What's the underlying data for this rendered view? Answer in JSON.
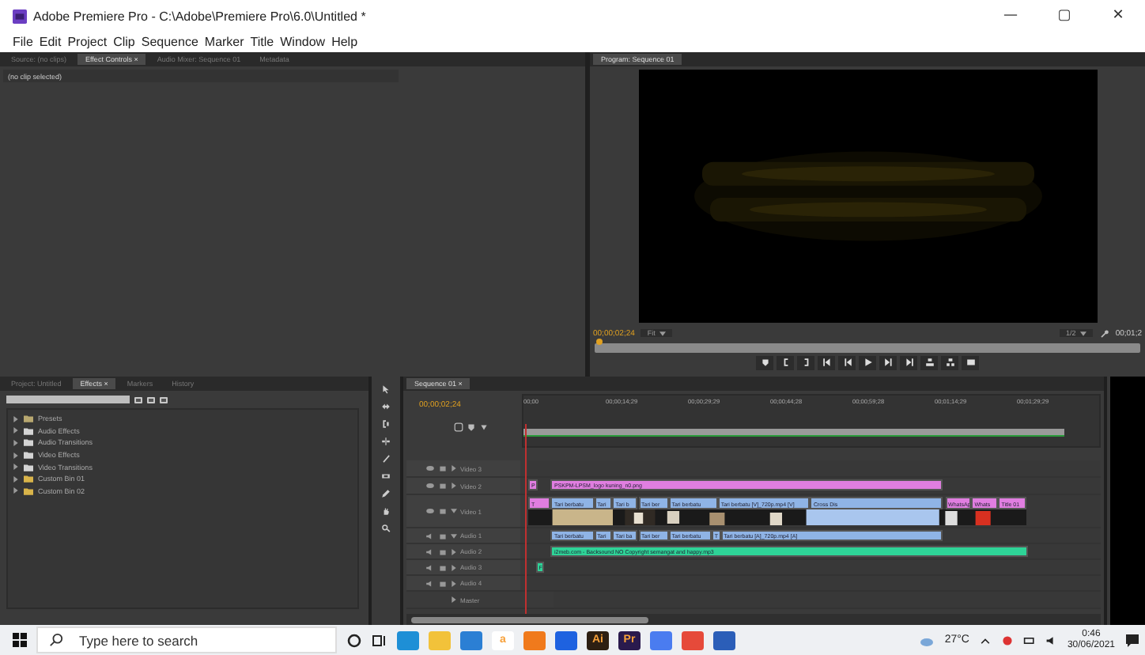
{
  "window": {
    "title": "Adobe Premiere Pro - C:\\Adobe\\Premiere Pro\\6.0\\Untitled *",
    "controls": [
      "—",
      "▢",
      "✕"
    ]
  },
  "menu": [
    "File",
    "Edit",
    "Project",
    "Clip",
    "Sequence",
    "Marker",
    "Title",
    "Window",
    "Help"
  ],
  "source_panel": {
    "tabs": [
      {
        "label": "Source: (no clips)",
        "selected": false
      },
      {
        "label": "Effect Controls ×",
        "selected": true
      },
      {
        "label": "Audio Mixer: Sequence 01",
        "selected": false
      },
      {
        "label": "Metadata",
        "selected": false
      }
    ],
    "message": "(no clip selected)"
  },
  "program_monitor": {
    "tab": "Program: Sequence 01",
    "timecode": "00;00;02;24",
    "fit": "Fit",
    "zoom": "1/2",
    "duration": "00;01;2"
  },
  "project_panel": {
    "tabs": [
      {
        "label": "Project: Untitled",
        "selected": false
      },
      {
        "label": "Effects ×",
        "selected": true
      },
      {
        "label": "Markers",
        "selected": false
      },
      {
        "label": "History",
        "selected": false
      }
    ],
    "items": [
      {
        "label": "Presets",
        "kind": "presets"
      },
      {
        "label": "Audio Effects",
        "kind": "folder"
      },
      {
        "label": "Audio Transitions",
        "kind": "folder"
      },
      {
        "label": "Video Effects",
        "kind": "folder"
      },
      {
        "label": "Video Transitions",
        "kind": "folder"
      },
      {
        "label": "Custom Bin 01",
        "kind": "bin"
      },
      {
        "label": "Custom Bin 02",
        "kind": "bin"
      }
    ]
  },
  "timeline": {
    "tab": "Sequence 01 ×",
    "timecode": "00;00;02;24",
    "ruler": [
      "00;00",
      "00;00;14;29",
      "00;00;29;29",
      "00;00;44;28",
      "00;00;59;28",
      "00;01;14;29",
      "00;01;29;29"
    ],
    "tracks": [
      {
        "name": "Video 3",
        "kind": "video",
        "expanded": false
      },
      {
        "name": "Video 2",
        "kind": "video",
        "expanded": false,
        "clips": [
          {
            "label": "P",
            "color": "#e07ee0"
          },
          {
            "label": "PSKPM-LPSM_logo kuning_n0.png",
            "color": "#e07ee0"
          }
        ]
      },
      {
        "name": "Video 1",
        "kind": "video",
        "expanded": true,
        "clips": [
          {
            "label": "T",
            "color": "#e07ee0"
          },
          {
            "label": "Tari berbatu",
            "color": "#8fb4e6"
          },
          {
            "label": "Tari",
            "color": "#8fb4e6"
          },
          {
            "label": "Tari b",
            "color": "#8fb4e6"
          },
          {
            "label": "Tari ber",
            "color": "#8fb4e6"
          },
          {
            "label": "Tari berbatu",
            "color": "#8fb4e6"
          },
          {
            "label": "Tari berbatu [V]_720p.mp4 [V]",
            "color": "#8fb4e6"
          },
          {
            "label": "Cross Dis",
            "color": "#8fb4e6"
          },
          {
            "label": "WhatsAp",
            "color": "#e07ee0"
          },
          {
            "label": "Whats",
            "color": "#e07ee0"
          },
          {
            "label": "Title 01",
            "color": "#e07ee0"
          }
        ]
      },
      {
        "name": "Audio 1",
        "kind": "audio",
        "expanded": true,
        "clips": [
          {
            "label": "Tari berbatu",
            "color": "#8fb4e6"
          },
          {
            "label": "Tari",
            "color": "#8fb4e6"
          },
          {
            "label": "Tari ba",
            "color": "#8fb4e6"
          },
          {
            "label": "Tari ber",
            "color": "#8fb4e6"
          },
          {
            "label": "Tari berbatu",
            "color": "#8fb4e6"
          },
          {
            "label": "T",
            "color": "#8fb4e6"
          },
          {
            "label": "Tari berbatu [A]_720p.mp4 [A]",
            "color": "#8fb4e6"
          }
        ]
      },
      {
        "name": "Audio 2",
        "kind": "audio",
        "expanded": false,
        "clips": [
          {
            "label": "i2meb.com - Backsound NO Copyright semangat and happy.mp3",
            "color": "#2ed397"
          }
        ]
      },
      {
        "name": "Audio 3",
        "kind": "audio",
        "expanded": false,
        "clips": [
          {
            "label": "F",
            "color": "#2ed397"
          }
        ]
      },
      {
        "name": "Audio 4",
        "kind": "audio",
        "expanded": false
      },
      {
        "name": "Master",
        "kind": "master",
        "expanded": false
      }
    ]
  },
  "taskbar": {
    "search": {
      "placeholder": "Type here to search"
    },
    "apps": [
      {
        "color": "#1e8fd6"
      },
      {
        "color": "#f2c23a"
      },
      {
        "color": "#2b7fd4"
      },
      {
        "label": "a",
        "color": "#ffffff"
      },
      {
        "color": "#f07a1c"
      },
      {
        "color": "#1e62e0"
      },
      {
        "label": "Ai",
        "color": "#2d1f12"
      },
      {
        "label": "Pr",
        "color": "#2a1a4d"
      },
      {
        "color": "#4a7cf0"
      },
      {
        "color": "#e64a3a"
      },
      {
        "color": "#2b5eb8"
      }
    ],
    "weather": "27°C",
    "time": "0:46",
    "date": "30/06/2021"
  }
}
